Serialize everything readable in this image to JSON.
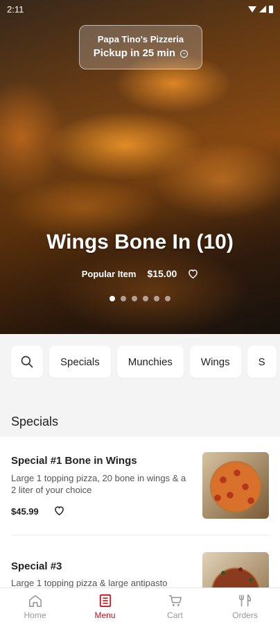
{
  "status_bar": {
    "time": "2:11"
  },
  "store": {
    "name": "Papa Tino's Pizzeria",
    "pickup": "Pickup in 25 min"
  },
  "hero": {
    "title": "Wings Bone In (10)",
    "badge": "Popular Item",
    "price": "$15.00",
    "carousel_total": 6,
    "carousel_active": 1
  },
  "categories": [
    "Specials",
    "Munchies",
    "Wings",
    "S"
  ],
  "section": {
    "title": "Specials"
  },
  "items": [
    {
      "name": "Special #1 Bone in Wings",
      "description": "Large 1 topping pizza, 20 bone in wings & a 2 liter of your choice",
      "price": "$45.99"
    },
    {
      "name": "Special #3",
      "description": "Large 1 topping pizza & large antipasto"
    }
  ],
  "nav": [
    {
      "label": "Home",
      "icon": "home-icon"
    },
    {
      "label": "Menu",
      "icon": "menu-icon"
    },
    {
      "label": "Cart",
      "icon": "cart-icon"
    },
    {
      "label": "Orders",
      "icon": "orders-icon"
    }
  ],
  "colors": {
    "accent": "#c0101a",
    "inactive": "#999999",
    "category_bg": "#f4f4f4"
  }
}
